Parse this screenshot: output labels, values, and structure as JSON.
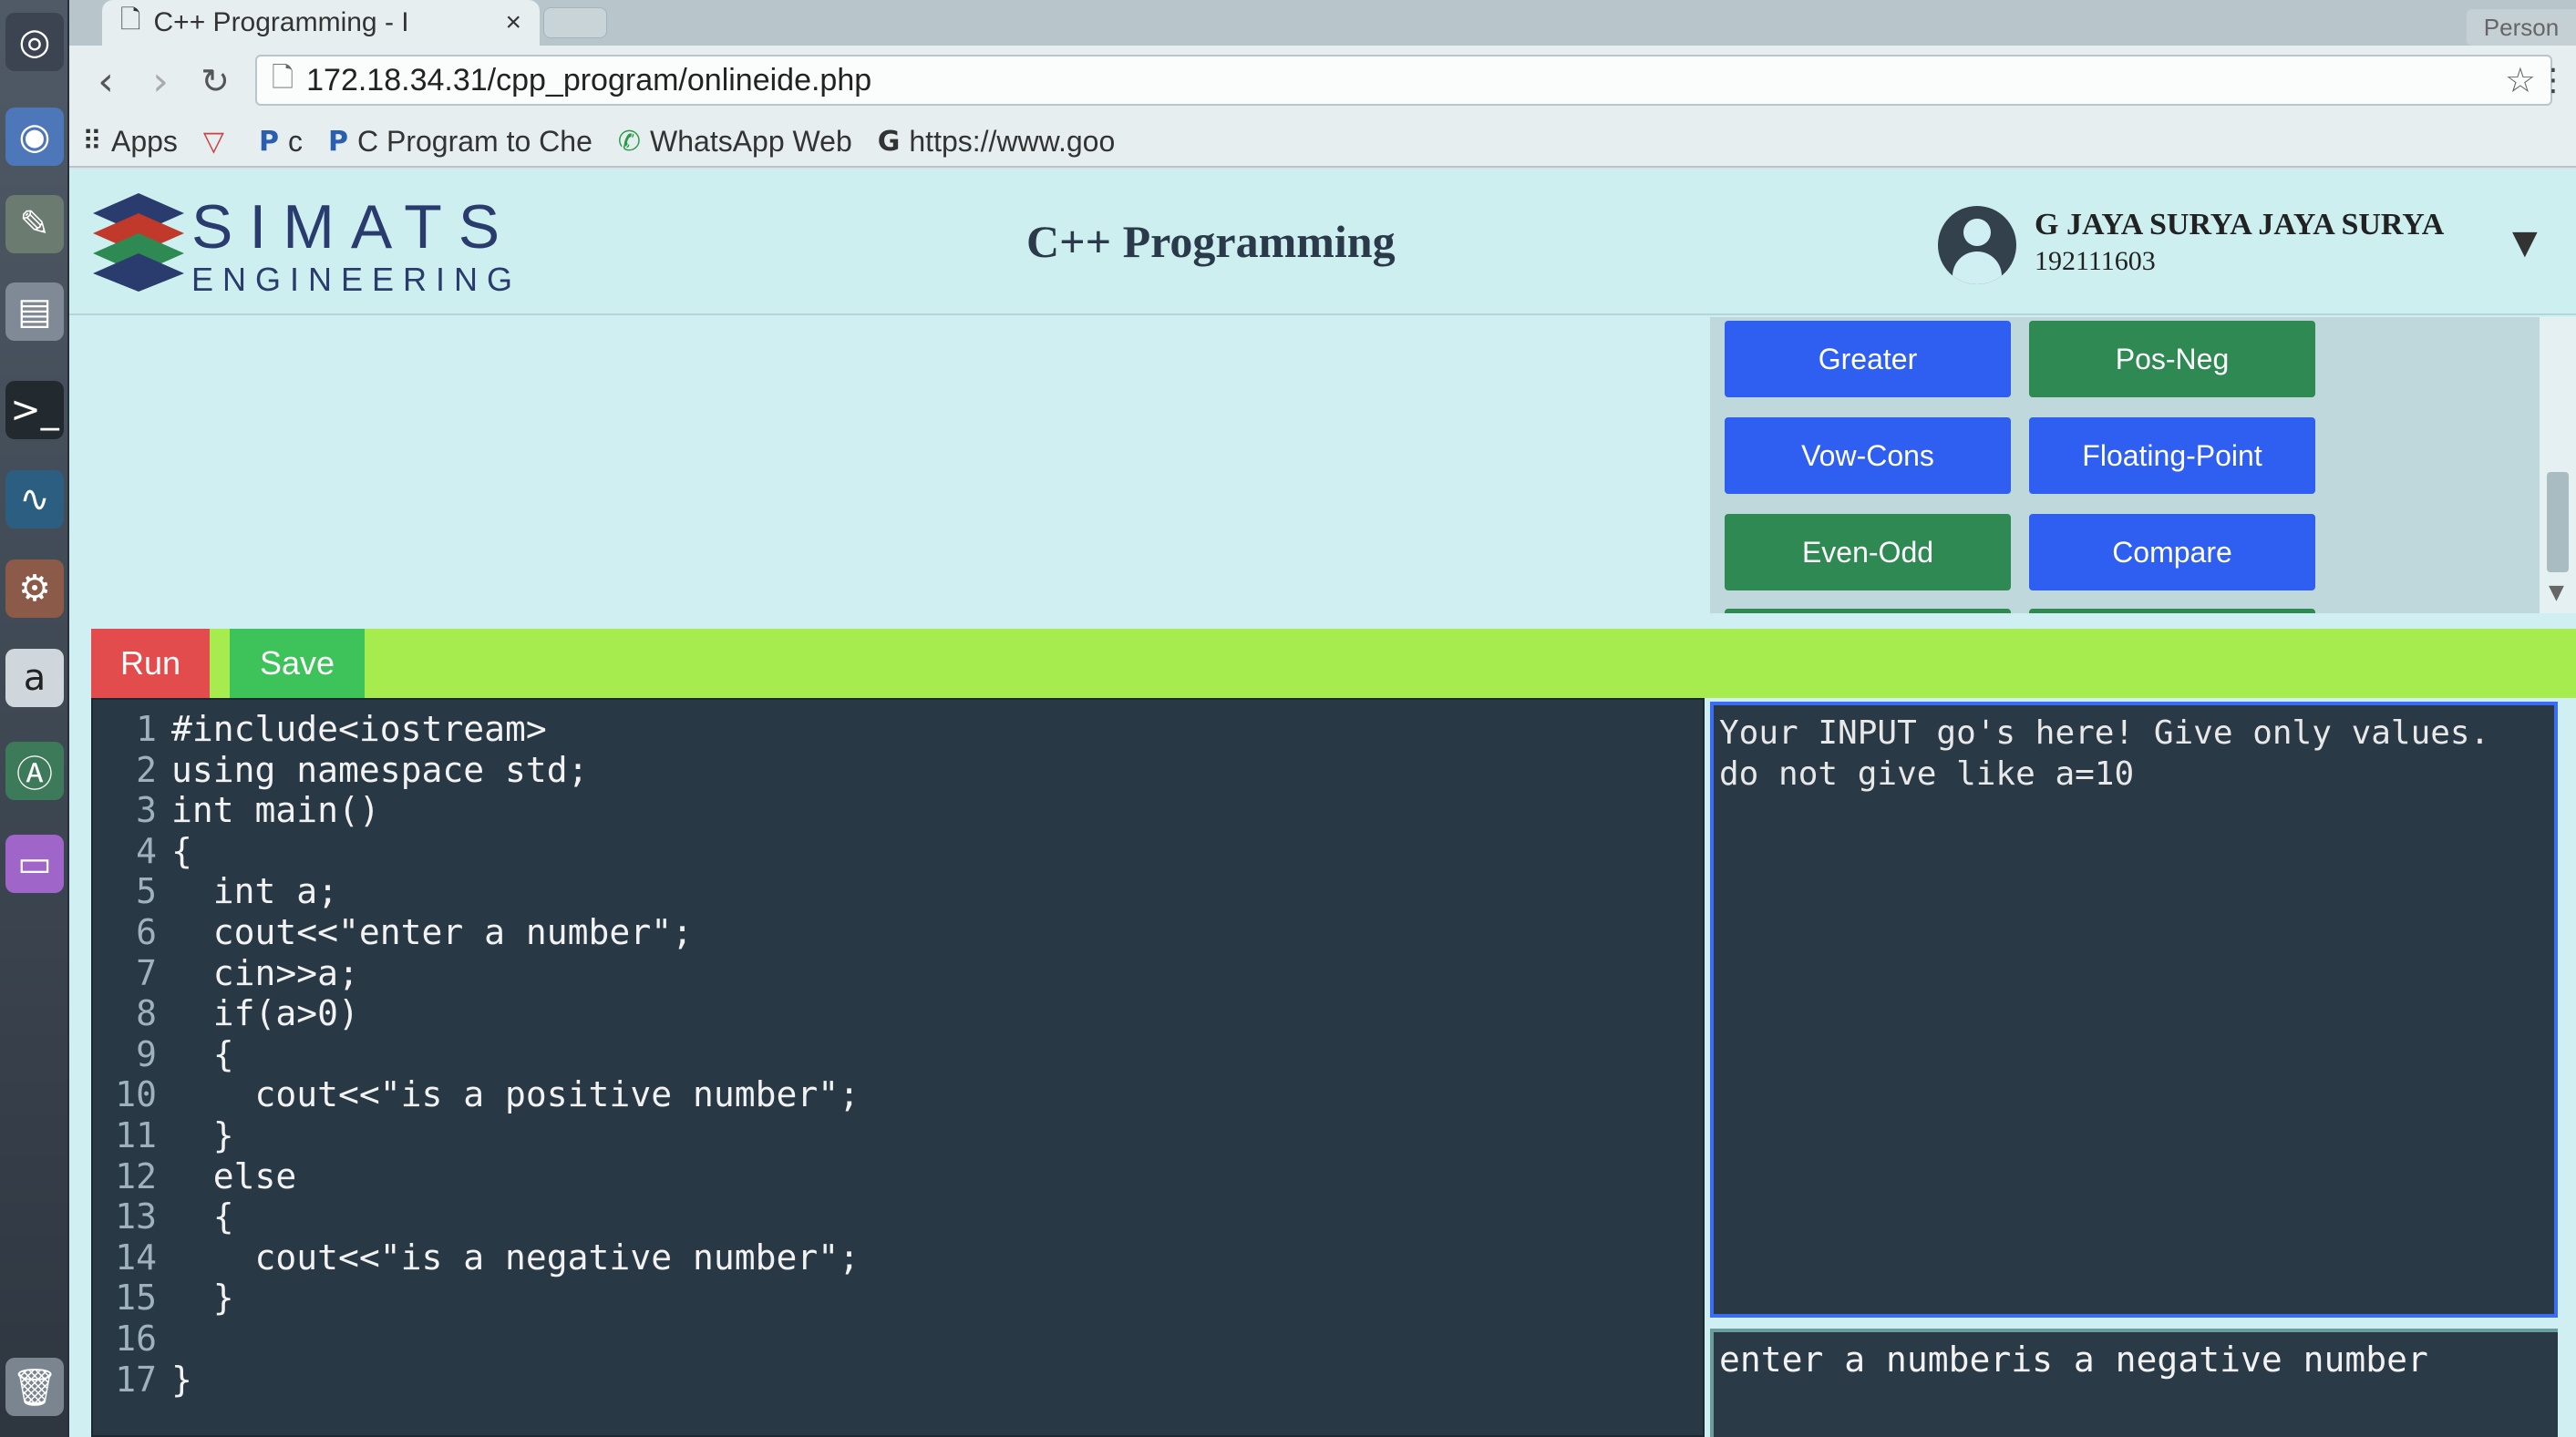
{
  "browser": {
    "tab_title": "C++ Programming - I",
    "tab_close": "×",
    "url": "172.18.34.31/cpp_program/onlineide.php",
    "profile": "Person",
    "bookmarks": [
      {
        "icon": "apps-grid-icon",
        "label": "Apps"
      },
      {
        "icon": "v-logo-icon",
        "label": ""
      },
      {
        "icon": "p-logo-icon",
        "label": "c"
      },
      {
        "icon": "p-logo-icon",
        "label": "C Program to Che"
      },
      {
        "icon": "whatsapp-icon",
        "label": "WhatsApp Web"
      },
      {
        "icon": "google-icon",
        "label": "https://www.goo"
      }
    ]
  },
  "header": {
    "brand_main": "SIMATS",
    "brand_sub": "ENGINEERING",
    "title": "C++ Programming",
    "user_name": "G JAYA SURYA JAYA SURYA",
    "user_id": "192111603"
  },
  "snippets": [
    {
      "label": "Greater",
      "color": "blue"
    },
    {
      "label": "Pos-Neg",
      "color": "green"
    },
    {
      "label": "Vow-Cons",
      "color": "blue"
    },
    {
      "label": "Floating-Point",
      "color": "blue"
    },
    {
      "label": "Even-Odd",
      "color": "green"
    },
    {
      "label": "Compare",
      "color": "blue"
    }
  ],
  "actions": {
    "run_label": "Run",
    "save_label": "Save"
  },
  "code_lines": [
    {
      "n": "1",
      "text": "#include<iostream>"
    },
    {
      "n": "2",
      "text": "using namespace std;"
    },
    {
      "n": "3",
      "text": "int main()"
    },
    {
      "n": "4",
      "text": "{"
    },
    {
      "n": "5",
      "text": "  int a;"
    },
    {
      "n": "6",
      "text": "  cout<<\"enter a number\";"
    },
    {
      "n": "7",
      "text": "  cin>>a;"
    },
    {
      "n": "8",
      "text": "  if(a>0)"
    },
    {
      "n": "9",
      "text": "  {"
    },
    {
      "n": "10",
      "text": "    cout<<\"is a positive number\";"
    },
    {
      "n": "11",
      "text": "  }"
    },
    {
      "n": "12",
      "text": "  else"
    },
    {
      "n": "13",
      "text": "  {"
    },
    {
      "n": "14",
      "text": "    cout<<\"is a negative number\";"
    },
    {
      "n": "15",
      "text": "  }"
    },
    {
      "n": "16",
      "text": ""
    },
    {
      "n": "17",
      "text": "}"
    }
  ],
  "input_panel": {
    "placeholder": "Your INPUT go's here! Give only values.\ndo not give like a=10"
  },
  "output_panel": {
    "text": "enter a numberis a negative number"
  },
  "colors": {
    "run": "#e34c4c",
    "save": "#3ec25a",
    "action_bar": "#a7ec4f",
    "editor_bg": "#283845",
    "button_blue": "#2f5ff0",
    "button_green": "#2e8a52"
  }
}
